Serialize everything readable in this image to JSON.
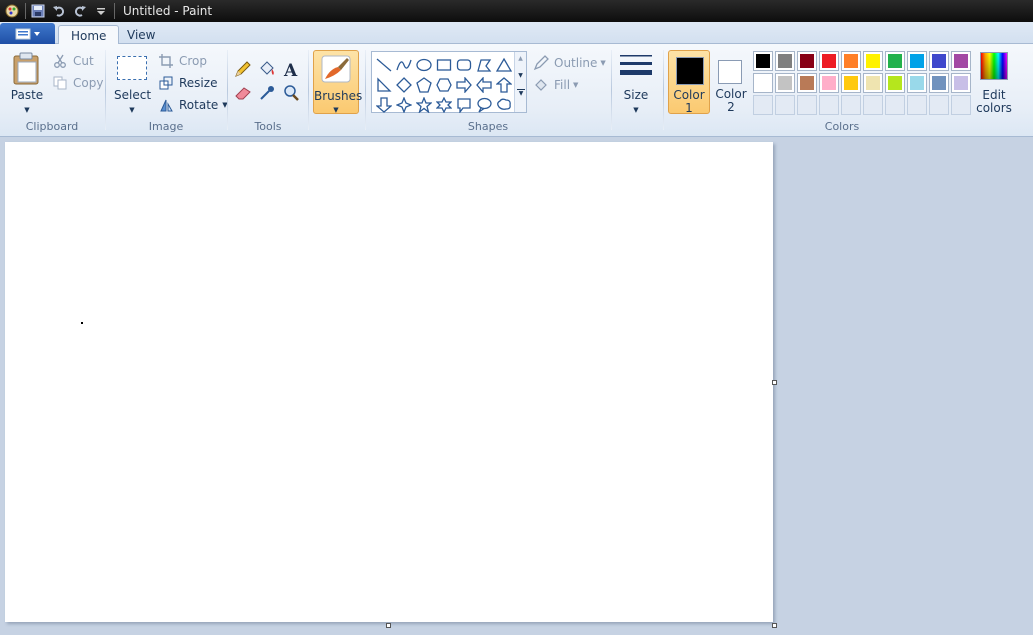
{
  "window": {
    "title": "Untitled - Paint"
  },
  "tabs": [
    {
      "label": "Home"
    },
    {
      "label": "View"
    }
  ],
  "clipboard": {
    "group_label": "Clipboard",
    "paste": "Paste",
    "cut": "Cut",
    "copy": "Copy"
  },
  "image": {
    "group_label": "Image",
    "select": "Select",
    "crop": "Crop",
    "resize": "Resize",
    "rotate": "Rotate"
  },
  "tools": {
    "group_label": "Tools"
  },
  "brushes": {
    "label": "Brushes"
  },
  "shapes": {
    "group_label": "Shapes",
    "outline": "Outline",
    "fill": "Fill"
  },
  "size": {
    "label": "Size"
  },
  "colors": {
    "group_label": "Colors",
    "color1_label_a": "Color",
    "color1_label_b": "1",
    "color2_label_a": "Color",
    "color2_label_b": "2",
    "color1_value": "#000000",
    "color2_value": "#ffffff",
    "edit_a": "Edit",
    "edit_b": "colors",
    "palette_row1": [
      "#000000",
      "#7f7f7f",
      "#880015",
      "#ed1c24",
      "#ff7f27",
      "#fff200",
      "#22b14c",
      "#00a2e8",
      "#3f48cc",
      "#a349a4"
    ],
    "palette_row2": [
      "#ffffff",
      "#c3c3c3",
      "#b97a57",
      "#ffaec9",
      "#ffc90e",
      "#efe4b0",
      "#b5e61d",
      "#99d9ea",
      "#7092be",
      "#c8bfe7"
    ]
  }
}
